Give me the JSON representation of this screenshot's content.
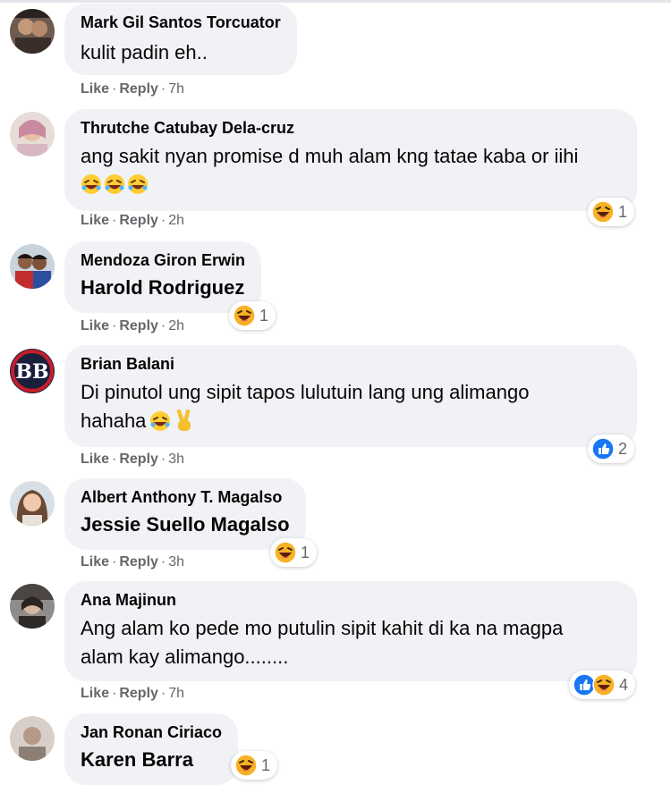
{
  "actions": {
    "like": "Like",
    "reply": "Reply",
    "sep": "·"
  },
  "comments": [
    {
      "author": "Mark Gil Santos Torcuator",
      "lines": [
        "kulit padin eh.."
      ],
      "time": "7h"
    },
    {
      "author": "Thrutche Catubay Dela-cruz",
      "lines": [
        "ang sakit nyan promise d muh alam kng tatae kaba or iihi"
      ],
      "emojis": [
        "rofl-emoji",
        "rofl-emoji",
        "rofl-emoji"
      ],
      "time": "2h",
      "reaction_count": "1",
      "reactions": [
        "haha"
      ]
    },
    {
      "author": "Mendoza Giron Erwin",
      "tag": "Harold Rodriguez",
      "time": "2h",
      "reaction_count": "1",
      "reactions": [
        "haha"
      ]
    },
    {
      "author": "Brian Balani",
      "lines": [
        "Di pinutol ung sipit tapos lulutuin lang ung alimango",
        "hahaha"
      ],
      "emojis": [
        "rofl-emoji",
        "victory-hand-emoji"
      ],
      "time": "3h",
      "reaction_count": "2",
      "reactions": [
        "like"
      ]
    },
    {
      "author": "Albert Anthony T. Magalso",
      "tag": "Jessie Suello Magalso",
      "time": "3h",
      "reaction_count": "1",
      "reactions": [
        "haha"
      ]
    },
    {
      "author": "Ana Majinun",
      "lines": [
        "Ang alam ko pede mo putulin sipit kahit di ka na magpa",
        "alam kay alimango........"
      ],
      "time": "7h",
      "reaction_count": "4",
      "reactions": [
        "like",
        "haha"
      ]
    },
    {
      "author": "Jan Ronan Ciriaco",
      "tag": "Karen Barra",
      "reaction_count": "1",
      "reactions": [
        "haha"
      ]
    }
  ],
  "colors": {
    "bubble": "#f0f2f5",
    "meta": "#65676b",
    "like_blue": "#1877f2",
    "haha_yellow": "#f7b125"
  }
}
